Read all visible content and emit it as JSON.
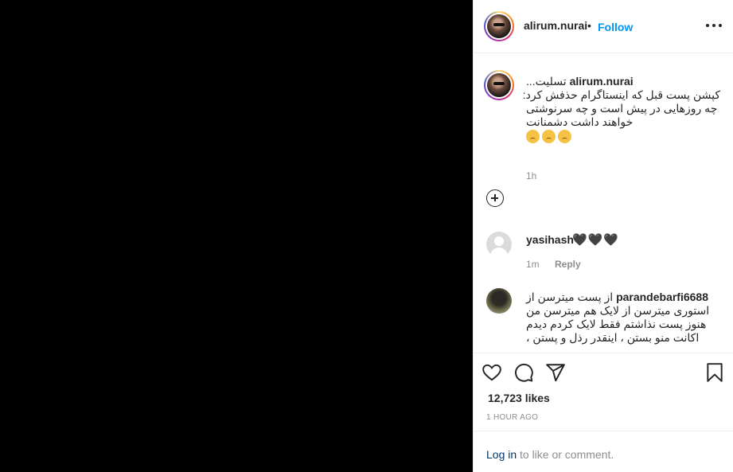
{
  "post": {
    "username": "alirum.nurai",
    "dot": "•",
    "follow_label": "Follow",
    "more_icon": "more-options-icon"
  },
  "caption": {
    "username": "alirum.nurai",
    "lines": [
      "تسلیت...",
      "کپشن پست قبل که اینستاگرام حذفش کرد:",
      "چه روزهایی در پیش است و چه سرنوشتی خواهند داشت دشمنانت"
    ],
    "emoji": [
      "😔",
      "😔",
      "😔"
    ],
    "time": "1h"
  },
  "comments": [
    {
      "username": "yasihash",
      "text": "🖤🖤🖤",
      "time": "1m",
      "reply_label": "Reply"
    },
    {
      "username": "parandebarfi6688",
      "text": "از پست میترسن از استوری میترسن از لایک هم میترسن من هنوز پست نذاشتم فقط لایک کردم دیدم اکانت منو بستن ، اینقدر رذل و پستن ،"
    }
  ],
  "actions": {
    "like_icon": "heart-icon",
    "comment_icon": "comment-icon",
    "share_icon": "share-icon",
    "save_icon": "bookmark-icon",
    "likes": "12,723 likes",
    "time_ago": "1 HOUR AGO"
  },
  "login": {
    "link": "Log in",
    "rest": "to like or comment."
  },
  "colors": {
    "link_blue": "#0095f6",
    "muted": "#8e8e8e",
    "text": "#262626",
    "border": "#efefef"
  }
}
